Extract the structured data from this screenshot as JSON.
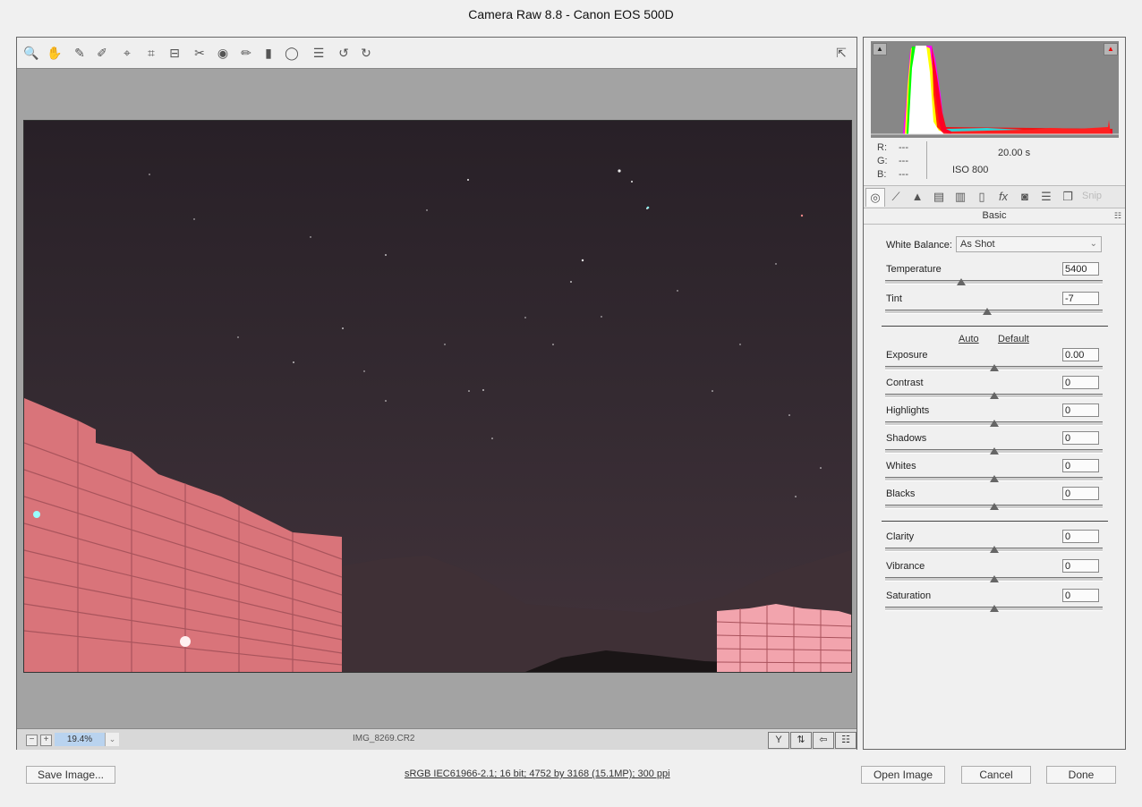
{
  "window": {
    "title": "Camera Raw 8.8  -  Canon EOS 500D"
  },
  "toolbar": {
    "tools": [
      {
        "name": "zoom-tool-icon",
        "glyph": "🔍"
      },
      {
        "name": "hand-tool-icon",
        "glyph": "✋"
      },
      {
        "name": "white-balance-tool-icon",
        "glyph": "✎"
      },
      {
        "name": "color-sampler-tool-icon",
        "glyph": "✐"
      },
      {
        "name": "targeted-adjustment-tool-icon",
        "glyph": "⌖"
      },
      {
        "name": "crop-tool-icon",
        "glyph": "⌗"
      },
      {
        "name": "straighten-tool-icon",
        "glyph": "⊟"
      },
      {
        "name": "spot-removal-tool-icon",
        "glyph": "✂"
      },
      {
        "name": "red-eye-removal-icon",
        "glyph": "◉"
      },
      {
        "name": "adjustment-brush-icon",
        "glyph": "✏"
      },
      {
        "name": "graduated-filter-icon",
        "glyph": "▮"
      },
      {
        "name": "radial-filter-icon",
        "glyph": "◯"
      },
      {
        "name": "preferences-icon",
        "glyph": "☰"
      },
      {
        "name": "rotate-left-icon",
        "glyph": "↺"
      },
      {
        "name": "rotate-right-icon",
        "glyph": "↻"
      }
    ],
    "fullscreen_glyph": "⇱"
  },
  "viewer": {
    "zoom_out": "−",
    "zoom_in": "+",
    "zoom_level": "19.4%",
    "zoom_dropdown": "⌄",
    "filename": "IMG_8269.CR2",
    "view_buttons": [
      {
        "name": "before-after-view-button",
        "glyph": "Y"
      },
      {
        "name": "swap-settings-button",
        "glyph": "⇅"
      },
      {
        "name": "copy-settings-button",
        "glyph": "⇦"
      },
      {
        "name": "toggle-settings-button",
        "glyph": "☷"
      }
    ]
  },
  "histogram": {
    "shadow_clip": "▲",
    "highlight_clip": "▲",
    "r_label": "R:",
    "r_value": "---",
    "g_label": "G:",
    "g_value": "---",
    "b_label": "B:",
    "b_value": "---",
    "shutter": "20.00 s",
    "iso": "ISO 800"
  },
  "panel_tabs": [
    {
      "name": "tab-basic-icon",
      "glyph": "◎",
      "active": true
    },
    {
      "name": "tab-tone-curve-icon",
      "glyph": "⟋",
      "active": false
    },
    {
      "name": "tab-detail-icon",
      "glyph": "▲",
      "active": false
    },
    {
      "name": "tab-hsl-icon",
      "glyph": "▤",
      "active": false
    },
    {
      "name": "tab-split-toning-icon",
      "glyph": "▥",
      "active": false
    },
    {
      "name": "tab-lens-corrections-icon",
      "glyph": "▯",
      "active": false
    },
    {
      "name": "tab-effects-icon",
      "glyph": "fx",
      "active": false
    },
    {
      "name": "tab-camera-calibration-icon",
      "glyph": "◙",
      "active": false
    },
    {
      "name": "tab-presets-icon",
      "glyph": "☰",
      "active": false
    },
    {
      "name": "tab-snapshots-icon",
      "glyph": "❐",
      "active": false
    }
  ],
  "snip_label": "Snip",
  "panel": {
    "title": "Basic",
    "menu_glyph": "☷",
    "white_balance_label": "White Balance:",
    "white_balance_value": "As Shot",
    "white_balance_chevron": "⌄",
    "auto_link": "Auto",
    "default_link": "Default",
    "sliders": [
      {
        "name": "temperature",
        "label": "Temperature",
        "value": "5400",
        "position": 0.35
      },
      {
        "name": "tint",
        "label": "Tint",
        "value": "-7",
        "position": 0.47
      },
      {
        "name": "exposure",
        "label": "Exposure",
        "value": "0.00",
        "position": 0.5
      },
      {
        "name": "contrast",
        "label": "Contrast",
        "value": "0",
        "position": 0.5
      },
      {
        "name": "highlights",
        "label": "Highlights",
        "value": "0",
        "position": 0.5
      },
      {
        "name": "shadows",
        "label": "Shadows",
        "value": "0",
        "position": 0.5
      },
      {
        "name": "whites",
        "label": "Whites",
        "value": "0",
        "position": 0.5
      },
      {
        "name": "blacks",
        "label": "Blacks",
        "value": "0",
        "position": 0.5
      },
      {
        "name": "clarity",
        "label": "Clarity",
        "value": "0",
        "position": 0.5
      },
      {
        "name": "vibrance",
        "label": "Vibrance",
        "value": "0",
        "position": 0.5
      },
      {
        "name": "saturation",
        "label": "Saturation",
        "value": "0",
        "position": 0.5
      }
    ]
  },
  "footer": {
    "save_label": "Save Image...",
    "workflow_info": "sRGB IEC61966-2.1; 16 bit; 4752 by 3168 (15.1MP); 300 ppi",
    "open_label": "Open Image",
    "cancel_label": "Cancel",
    "done_label": "Done"
  }
}
